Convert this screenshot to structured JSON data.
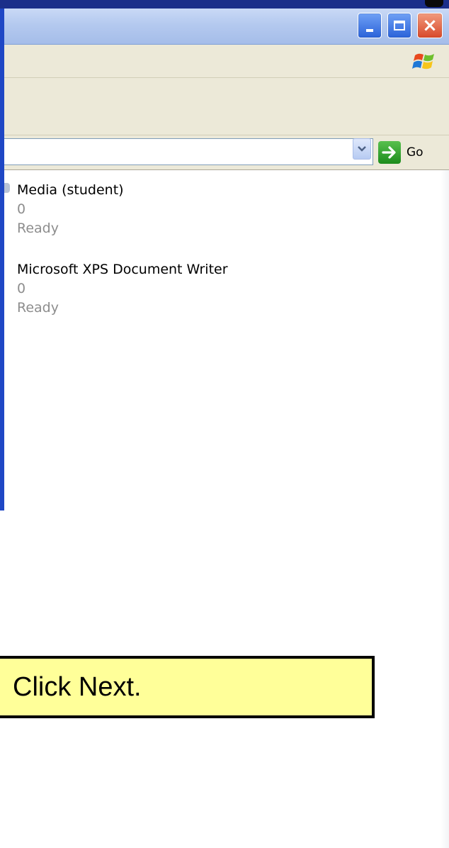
{
  "titlebar": {
    "buttons": [
      "minimize",
      "maximize",
      "close"
    ],
    "close_glyph": "×"
  },
  "addressbar": {
    "value": "",
    "go_label": "Go"
  },
  "printers": [
    {
      "name": "Media (student)",
      "documents": "0",
      "status": "Ready"
    },
    {
      "name": "Microsoft XPS Document Writer",
      "documents": "0",
      "status": "Ready"
    }
  ],
  "callout": {
    "text": "Click Next."
  },
  "colors": {
    "titlebar": "#b4c9ef",
    "window_border": "#1f47c5",
    "menubar": "#ece9d8",
    "callout_fill": "#ffff99",
    "go_green": "#1c8c1c"
  },
  "icons": [
    "minimize-icon",
    "maximize-icon",
    "close-icon",
    "windows-logo-icon",
    "dropdown-chevron-icon",
    "go-arrow-icon"
  ]
}
